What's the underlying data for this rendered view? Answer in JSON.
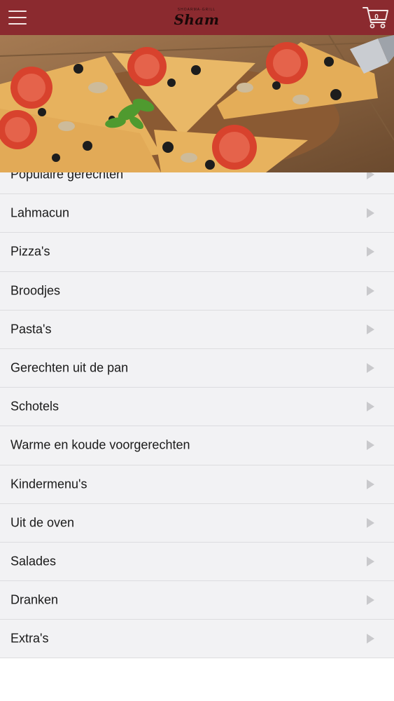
{
  "header": {
    "menu_icon": "hamburger-menu-icon",
    "logo_small": "Shoarma-Grill",
    "logo_main": "Sham",
    "cart_icon": "shopping-cart-icon",
    "cart_count": "0",
    "background_color": "#8b2a2f"
  },
  "hero": {
    "image": "pizza-slices-photo"
  },
  "categories": [
    {
      "label": "Populaire gerechten",
      "icon": "chevron-right-icon"
    },
    {
      "label": "Lahmacun",
      "icon": "chevron-right-icon"
    },
    {
      "label": "Pizza's",
      "icon": "chevron-right-icon"
    },
    {
      "label": "Broodjes",
      "icon": "chevron-right-icon"
    },
    {
      "label": "Pasta's",
      "icon": "chevron-right-icon"
    },
    {
      "label": "Gerechten uit de pan",
      "icon": "chevron-right-icon"
    },
    {
      "label": "Schotels",
      "icon": "chevron-right-icon"
    },
    {
      "label": "Warme en koude voorgerechten",
      "icon": "chevron-right-icon"
    },
    {
      "label": "Kindermenu's",
      "icon": "chevron-right-icon"
    },
    {
      "label": "Uit de oven",
      "icon": "chevron-right-icon"
    },
    {
      "label": "Salades",
      "icon": "chevron-right-icon"
    },
    {
      "label": "Dranken",
      "icon": "chevron-right-icon"
    },
    {
      "label": "Extra's",
      "icon": "chevron-right-icon"
    }
  ]
}
